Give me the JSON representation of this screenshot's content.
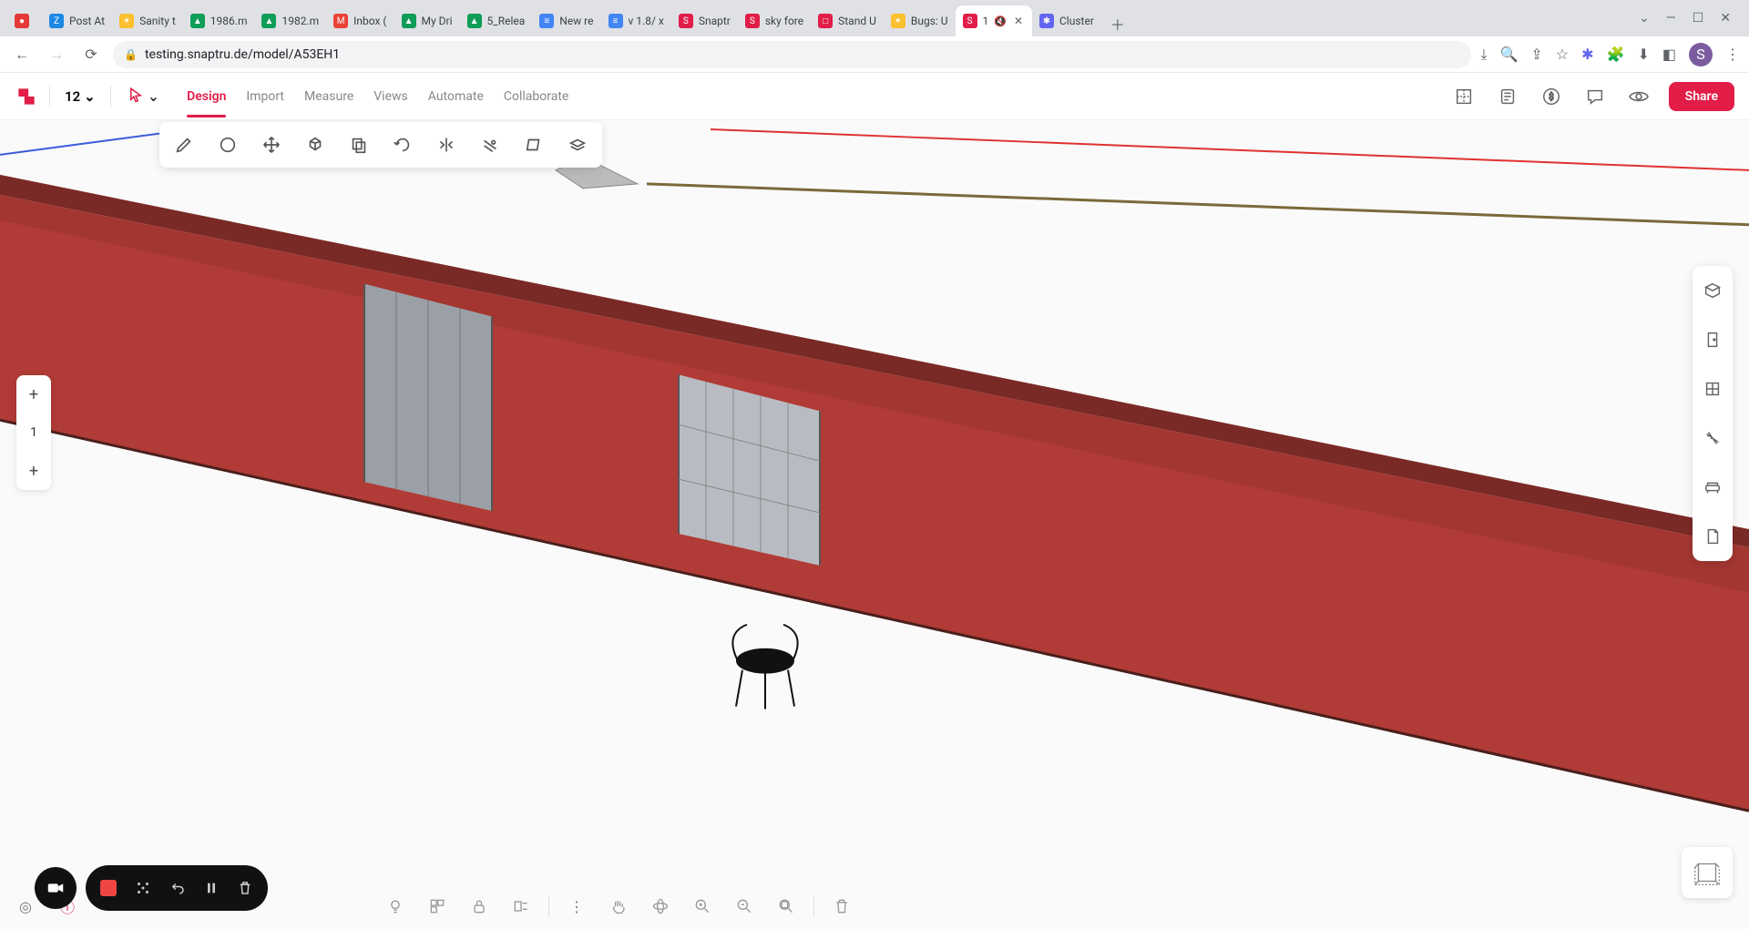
{
  "browser": {
    "tabs": [
      {
        "label": "",
        "favicon_bg": "#e53935",
        "favicon_txt": "●"
      },
      {
        "label": "Post At",
        "favicon_bg": "#1e88e5",
        "favicon_txt": "Z"
      },
      {
        "label": "Sanity t",
        "favicon_bg": "#fbc02d",
        "favicon_txt": "✶"
      },
      {
        "label": "1986.m",
        "favicon_bg": "#0f9d58",
        "favicon_txt": "▲"
      },
      {
        "label": "1982.m",
        "favicon_bg": "#0f9d58",
        "favicon_txt": "▲"
      },
      {
        "label": "Inbox (",
        "favicon_bg": "#ea4335",
        "favicon_txt": "M"
      },
      {
        "label": "My Dri",
        "favicon_bg": "#0f9d58",
        "favicon_txt": "▲"
      },
      {
        "label": "5_Relea",
        "favicon_bg": "#0f9d58",
        "favicon_txt": "▲"
      },
      {
        "label": "New re",
        "favicon_bg": "#4285f4",
        "favicon_txt": "≡"
      },
      {
        "label": "v 1.8/ x",
        "favicon_bg": "#4285f4",
        "favicon_txt": "≡"
      },
      {
        "label": "Snaptr",
        "favicon_bg": "#e11d48",
        "favicon_txt": "S"
      },
      {
        "label": "sky fore",
        "favicon_bg": "#e11d48",
        "favicon_txt": "S"
      },
      {
        "label": "Stand U",
        "favicon_bg": "#e11d48",
        "favicon_txt": "□"
      },
      {
        "label": "Bugs: U",
        "favicon_bg": "#fbc02d",
        "favicon_txt": "✶"
      },
      {
        "label": "1",
        "favicon_bg": "#e11d48",
        "favicon_txt": "S",
        "active": true,
        "muted": true,
        "closeable": true
      },
      {
        "label": "Cluster",
        "favicon_bg": "#6366f1",
        "favicon_txt": "✱"
      }
    ],
    "url": "testing.snaptru.de/model/A53EH1",
    "avatar_letter": "S"
  },
  "app": {
    "layer_value": "12",
    "tabs": [
      "Design",
      "Import",
      "Measure",
      "Views",
      "Automate",
      "Collaborate"
    ],
    "active_tab": "Design",
    "share_label": "Share",
    "floor_current": "1"
  },
  "design_tools": [
    "pencil-icon",
    "circle-icon",
    "move-icon",
    "pushpull-icon",
    "copy-icon",
    "rotate-icon",
    "mirror-icon",
    "offset-icon",
    "face-icon",
    "extrude-icon"
  ],
  "right_tools": [
    "materials-icon",
    "door-icon",
    "window-icon",
    "dimension-icon",
    "furniture-icon",
    "sheet-icon"
  ],
  "bottom_left_tools": [
    "info-icon"
  ],
  "bottom_center_tools": [
    "light-icon",
    "group-icon",
    "lock-icon",
    "unlink-icon"
  ],
  "bottom_right_tools": [
    "more-icon",
    "pan-icon",
    "orbit-icon",
    "zoom-in-icon",
    "zoom-out-icon",
    "zoom-fit-icon"
  ],
  "bottom_far_tools": [
    "trash-icon"
  ],
  "colors": {
    "accent": "#e11d48",
    "wall": "#b13b36"
  }
}
